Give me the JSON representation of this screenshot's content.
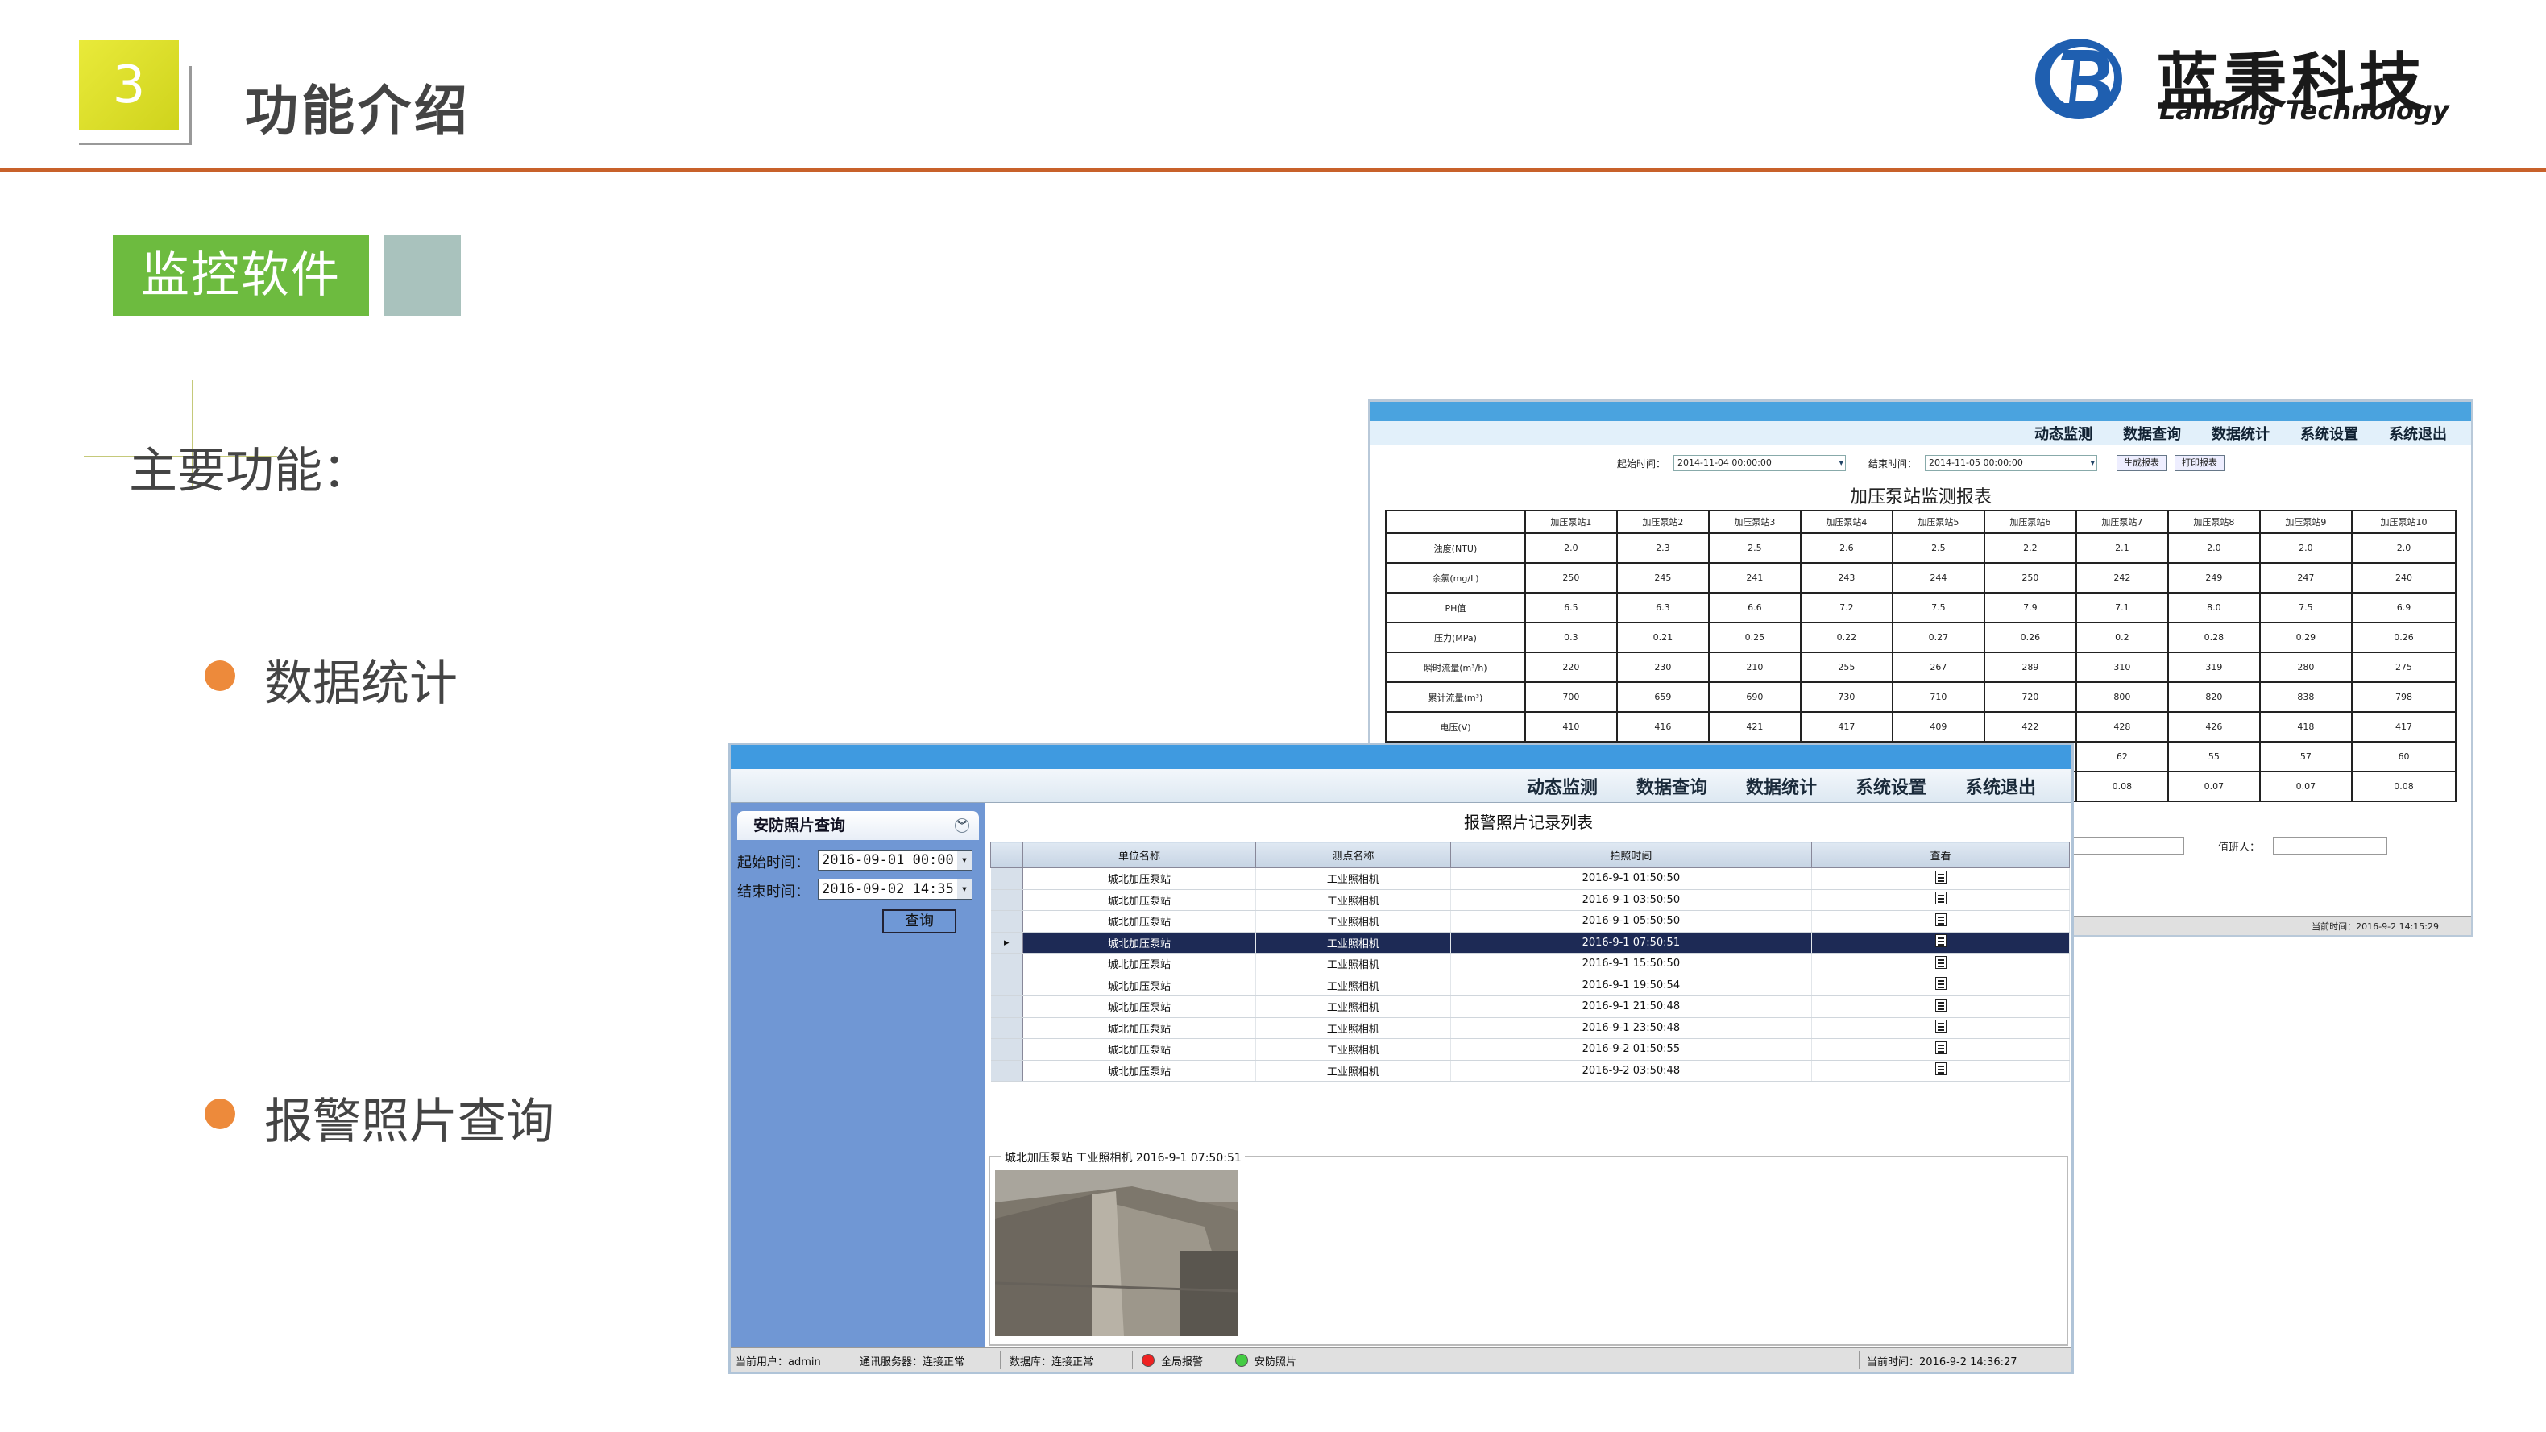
{
  "slide": {
    "number": "3",
    "title": "功能介绍",
    "logo_cn": "蓝秉科技",
    "logo_en": "LanBing Technology",
    "tag": "监控软件",
    "main_label": "主要功能：",
    "bullets": [
      "数据统计",
      "报警照片查询"
    ],
    "colors": {
      "accent_line": "#c8612a",
      "tag_green": "#6dbb3f",
      "bullet_orange": "#ed8a3b",
      "number_yellow": "#e9ea3a"
    }
  },
  "report_window": {
    "menu": [
      "动态监测",
      "数据查询",
      "数据统计",
      "系统设置",
      "系统退出"
    ],
    "start_label": "起始时间：",
    "start_value": "2014-11-04 00:00:00",
    "end_label": "结束时间：",
    "end_value": "2014-11-05 00:00:00",
    "generate_btn": "生成报表",
    "print_btn": "打印报表",
    "title": "加压泵站监测报表",
    "columns": [
      "加压泵站1",
      "加压泵站2",
      "加压泵站3",
      "加压泵站4",
      "加压泵站5",
      "加压泵站6",
      "加压泵站7",
      "加压泵站8",
      "加压泵站9",
      "加压泵站10"
    ],
    "rows": [
      {
        "label": "浊度(NTU)",
        "values": [
          "2.0",
          "2.3",
          "2.5",
          "2.6",
          "2.5",
          "2.2",
          "2.1",
          "2.0",
          "2.0",
          "2.0"
        ]
      },
      {
        "label": "余氯(mg/L)",
        "values": [
          "250",
          "245",
          "241",
          "243",
          "244",
          "250",
          "242",
          "249",
          "247",
          "240"
        ]
      },
      {
        "label": "PH值",
        "values": [
          "6.5",
          "6.3",
          "6.6",
          "7.2",
          "7.5",
          "7.9",
          "7.1",
          "8.0",
          "7.5",
          "6.9"
        ]
      },
      {
        "label": "压力(MPa)",
        "values": [
          "0.3",
          "0.21",
          "0.25",
          "0.22",
          "0.27",
          "0.26",
          "0.2",
          "0.28",
          "0.29",
          "0.26"
        ]
      },
      {
        "label": "瞬时流量(m³/h)",
        "values": [
          "220",
          "230",
          "210",
          "255",
          "267",
          "289",
          "310",
          "319",
          "280",
          "275"
        ]
      },
      {
        "label": "累计流量(m³)",
        "values": [
          "700",
          "659",
          "690",
          "730",
          "710",
          "720",
          "800",
          "820",
          "838",
          "798"
        ]
      },
      {
        "label": "电压(V)",
        "values": [
          "410",
          "416",
          "421",
          "417",
          "409",
          "422",
          "428",
          "426",
          "418",
          "417"
        ]
      },
      {
        "label": "",
        "values": [
          "",
          "",
          "",
          "",
          "",
          "",
          "62",
          "55",
          "57",
          "60"
        ]
      },
      {
        "label": "",
        "values": [
          "",
          "",
          "",
          "",
          "",
          "",
          "0.08",
          "0.07",
          "0.07",
          "0.08"
        ]
      }
    ],
    "duty_label": "值班人：",
    "footer_time": "当前时间：2016-9-2 14:15:29"
  },
  "alarm_window": {
    "menu": [
      "动态监测",
      "数据查询",
      "数据统计",
      "系统设置",
      "系统退出"
    ],
    "panel_title": "安防照片查询",
    "start_label": "起始时间：",
    "start_value": "2016-09-01 00:00",
    "end_label": "结束时间：",
    "end_value": "2016-09-02 14:35",
    "query_btn": "查询",
    "list_title": "报警照片记录列表",
    "headers": [
      "单位名称",
      "测点名称",
      "拍照时间",
      "查看"
    ],
    "rows": [
      {
        "unit": "城北加压泵站",
        "point": "工业照相机",
        "time": "2016-9-1 01:50:50"
      },
      {
        "unit": "城北加压泵站",
        "point": "工业照相机",
        "time": "2016-9-1 03:50:50"
      },
      {
        "unit": "城北加压泵站",
        "point": "工业照相机",
        "time": "2016-9-1 05:50:50"
      },
      {
        "unit": "城北加压泵站",
        "point": "工业照相机",
        "time": "2016-9-1 07:50:51"
      },
      {
        "unit": "城北加压泵站",
        "point": "工业照相机",
        "time": "2016-9-1 15:50:50"
      },
      {
        "unit": "城北加压泵站",
        "point": "工业照相机",
        "time": "2016-9-1 19:50:54"
      },
      {
        "unit": "城北加压泵站",
        "point": "工业照相机",
        "time": "2016-9-1 21:50:48"
      },
      {
        "unit": "城北加压泵站",
        "point": "工业照相机",
        "time": "2016-9-1 23:50:48"
      },
      {
        "unit": "城北加压泵站",
        "point": "工业照相机",
        "time": "2016-9-2 01:50:55"
      },
      {
        "unit": "城北加压泵站",
        "point": "工业照相机",
        "time": "2016-9-2 03:50:48"
      }
    ],
    "photo_caption": "城北加压泵站  工业照相机  2016-9-1 07:50:51",
    "footer": {
      "user": "当前用户：admin",
      "comm": "通讯服务器：连接正常",
      "db": "数据库：连接正常",
      "alarm": "全局报警",
      "security": "安防照片",
      "time": "当前时间：2016-9-2 14:36:27"
    }
  }
}
